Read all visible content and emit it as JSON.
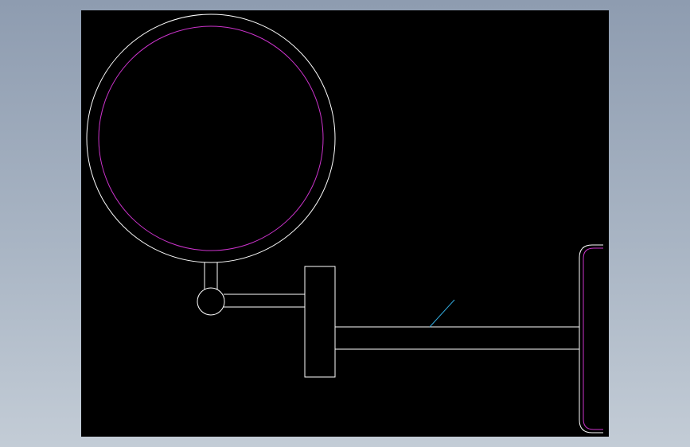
{
  "viewer": {
    "background_color": "#000000",
    "frame_gradient": [
      "#8e9cb0",
      "#c3ccd6"
    ]
  },
  "drawing": {
    "colors": {
      "outline": "#ffffff",
      "mirror_glass": "#cc33cc",
      "wall_plate_inner": "#cc33cc",
      "reflection_hint": "#33aadd"
    }
  }
}
